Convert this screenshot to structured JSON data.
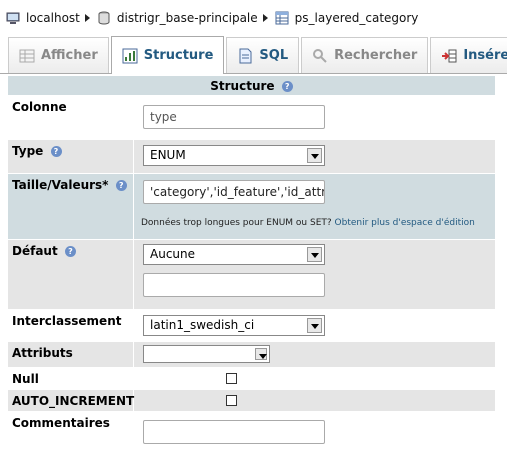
{
  "breadcrumb": {
    "server": "localhost",
    "database": "distrigr_base-principale",
    "table": "ps_layered_category"
  },
  "tabs": [
    {
      "label": "Afficher",
      "icon": "table-browse-icon",
      "state": "disabled"
    },
    {
      "label": "Structure",
      "icon": "structure-icon",
      "state": "active"
    },
    {
      "label": "SQL",
      "icon": "sql-icon",
      "state": "link"
    },
    {
      "label": "Rechercher",
      "icon": "search-icon",
      "state": "disabled"
    },
    {
      "label": "Insérer",
      "icon": "insert-icon",
      "state": "link"
    }
  ],
  "form": {
    "header": "Structure",
    "colonne": {
      "label": "Colonne",
      "value": "type"
    },
    "type": {
      "label": "Type",
      "value": "ENUM"
    },
    "taille": {
      "label": "Taille/Valeurs*",
      "value": "'category','id_feature','id_attribute'",
      "note": "Données trop longues pour ENUM ou SET?",
      "note_link": "Obtenir plus d'espace d'édition"
    },
    "defaut": {
      "label": "Défaut",
      "value": "Aucune",
      "extra_value": ""
    },
    "interclassement": {
      "label": "Interclassement",
      "value": "latin1_swedish_ci"
    },
    "attributs": {
      "label": "Attributs",
      "value": ""
    },
    "null": {
      "label": "Null",
      "checked": false
    },
    "auto_increment": {
      "label": "AUTO_INCREMENT",
      "checked": false
    },
    "commentaires": {
      "label": "Commentaires",
      "value": ""
    }
  },
  "colors": {
    "header_bg": "#d0dce0",
    "alt_row_bg": "#e5e5e5",
    "link": "#235a81"
  }
}
